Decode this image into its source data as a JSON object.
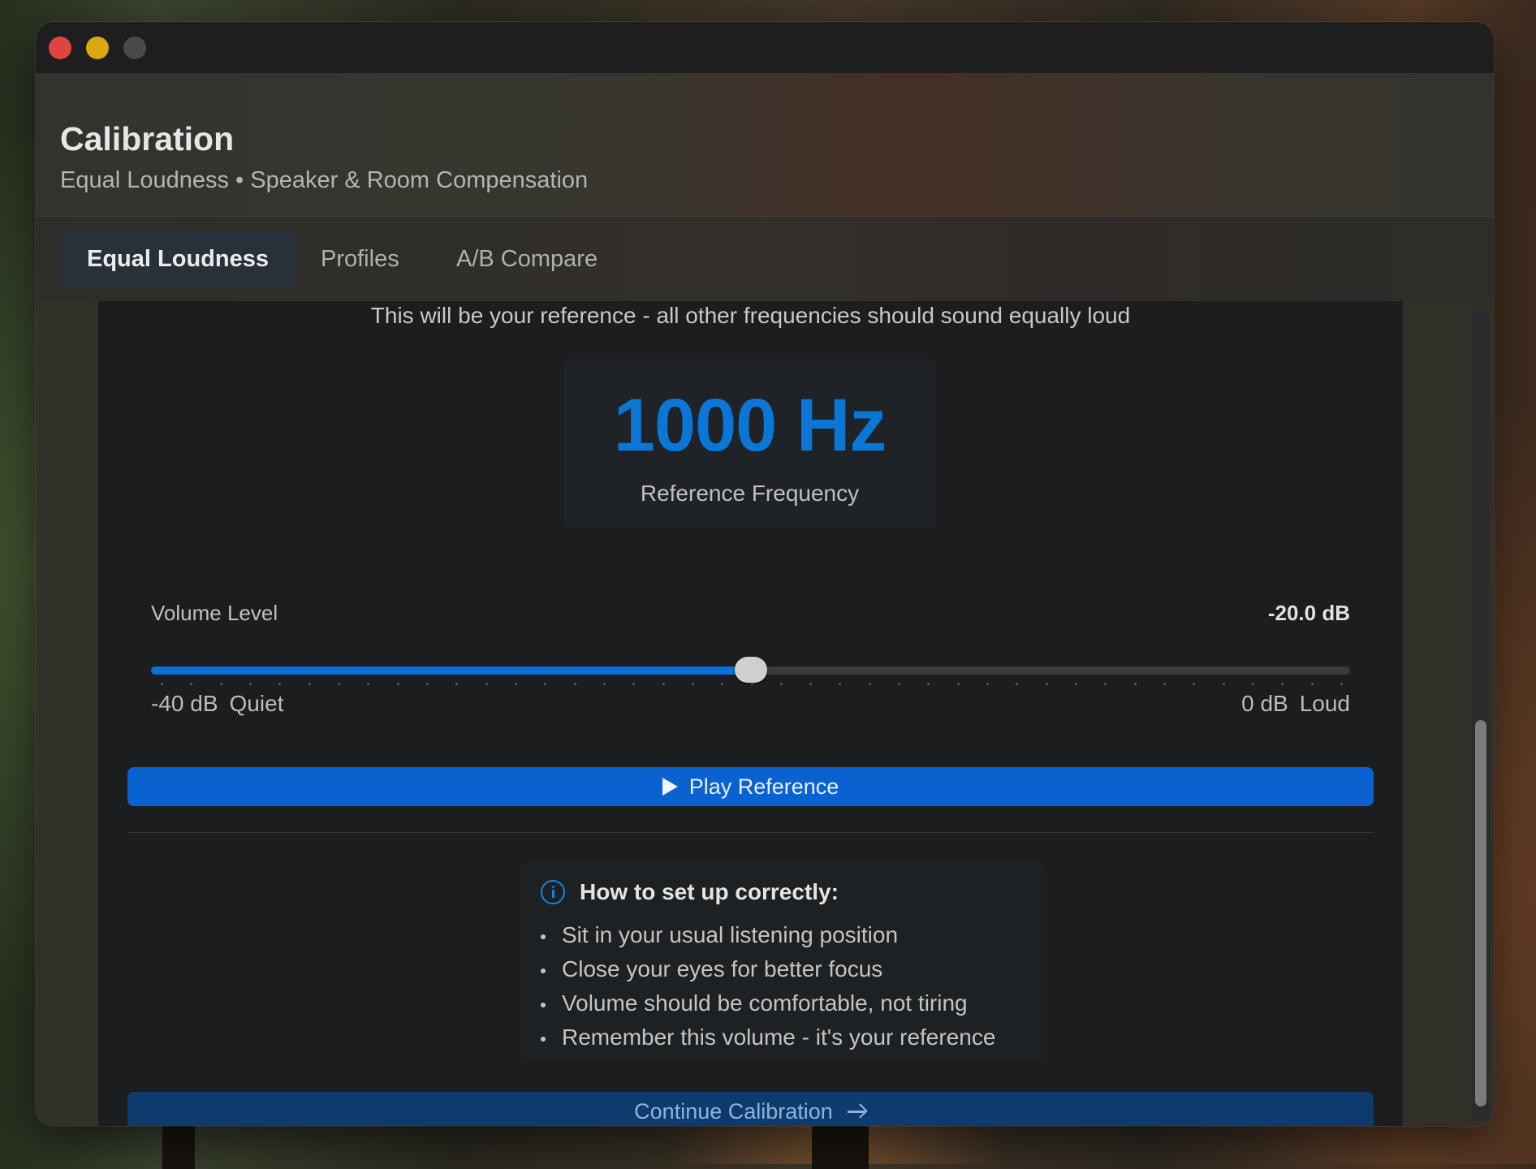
{
  "window": {
    "title": "Calibration",
    "subtitle": "Equal Loudness • Speaker & Room Compensation"
  },
  "tabs": [
    {
      "label": "Equal Loudness",
      "active": true
    },
    {
      "label": "Profiles",
      "active": false
    },
    {
      "label": "A/B Compare",
      "active": false
    }
  ],
  "main": {
    "intro": "This will be your reference - all other frequencies should sound equally loud",
    "frequency": {
      "value": "1000 Hz",
      "label": "Reference Frequency"
    },
    "volume": {
      "label": "Volume Level",
      "value_text": "-20.0 dB",
      "value_db": -20.0,
      "min_db": -40,
      "max_db": 0,
      "min_label": "-40 dB",
      "min_caption": "Quiet",
      "max_label": "0 dB",
      "max_caption": "Loud"
    },
    "play_button": "Play Reference",
    "howto": {
      "title": "How to set up correctly:",
      "items": [
        "Sit in your usual listening position",
        "Close your eyes for better focus",
        "Volume should be comfortable, not tiring",
        "Remember this volume - it's your reference"
      ]
    },
    "continue_button": "Continue Calibration"
  },
  "scroll": {
    "position_fraction": 0.5
  },
  "colors": {
    "accent": "#0a76d6",
    "button": "#0a62d0",
    "button_disabled": "#0e3a6e",
    "close": "#e0443e",
    "minimize": "#dba90f"
  },
  "icons": {
    "play": "play-icon",
    "info": "info-icon",
    "arrow": "arrow-right-icon"
  }
}
